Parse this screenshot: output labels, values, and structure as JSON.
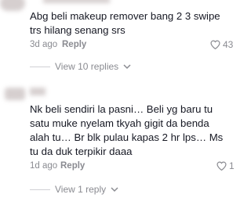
{
  "comments": [
    {
      "text": "Abg beli makeup remover bang 2 3 swipe trs hilang senang srs",
      "time": "3d ago",
      "reply_label": "Reply",
      "likes": "43",
      "view_replies": "View 10 replies"
    },
    {
      "text": "Nk beli sendiri la pasni… Beli yg baru tu satu muke nyelam tkyah gigit da benda alah tu… Br blk pulau kapas 2 hr lps… Ms tu da duk terpikir daaa",
      "time": "1d ago",
      "reply_label": "Reply",
      "likes": "1",
      "view_replies": "View 1 reply"
    }
  ]
}
